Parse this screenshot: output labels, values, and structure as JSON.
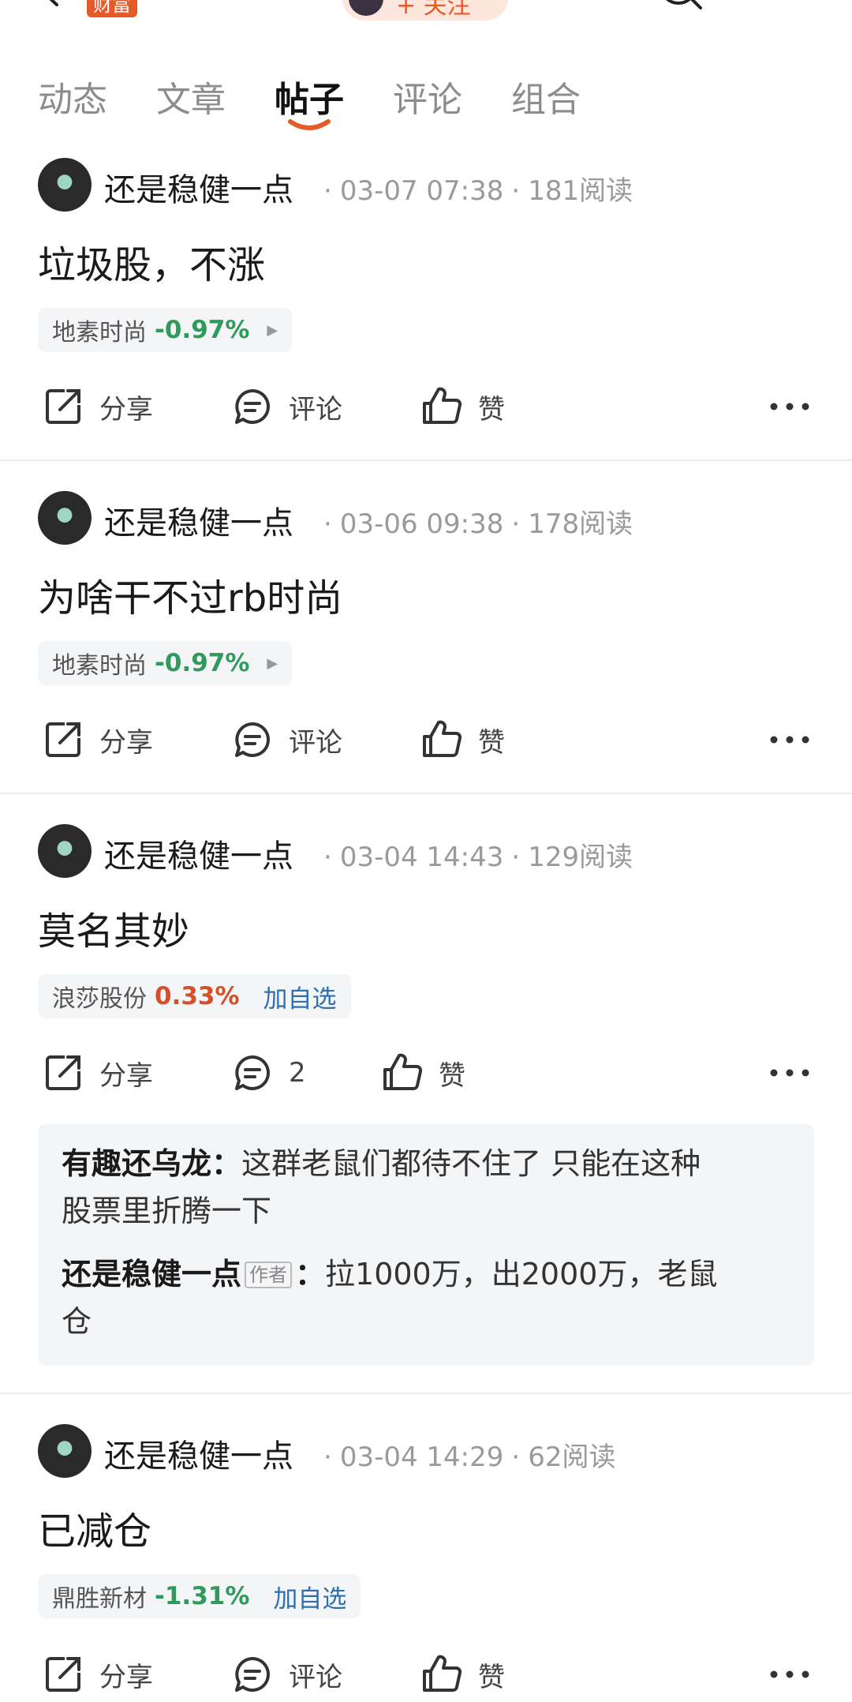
{
  "header": {
    "badge_label": "财富",
    "follow_label": "+ 关注"
  },
  "tabs": [
    {
      "label": "动态"
    },
    {
      "label": "文章"
    },
    {
      "label": "帖子"
    },
    {
      "label": "评论"
    },
    {
      "label": "组合"
    }
  ],
  "active_tab": "帖子",
  "action_labels": {
    "share": "分享",
    "comment": "评论",
    "like": "赞"
  },
  "posts": [
    {
      "author": "还是稳健一点",
      "time": "03-07 07:38",
      "reads": "181阅读",
      "content": "垃圾股，不涨",
      "stock": {
        "name": "地素时尚",
        "change": "-0.97%"
      },
      "comment_count": "评论"
    },
    {
      "author": "还是稳健一点",
      "time": "03-06 09:38",
      "reads": "178阅读",
      "content": "为啥干不过rb时尚",
      "stock": {
        "name": "地素时尚",
        "change": "-0.97%"
      },
      "comment_count": "评论"
    },
    {
      "author": "还是稳健一点",
      "time": "03-04 14:43",
      "reads": "129阅读",
      "content": "莫名其妙",
      "stock": {
        "name": "浪莎股份",
        "change": "0.33%",
        "add_watch": "加自选"
      },
      "comment_count": "2",
      "comments": [
        {
          "user": "有趣还乌龙",
          "text": "这群老鼠们都待不住了 只能在这种",
          "text2": "股票里折腾一下"
        },
        {
          "user": "还是稳健一点",
          "tag": "作者",
          "text": "拉1000万，出2000万，老鼠",
          "text2": "仓"
        }
      ]
    },
    {
      "author": "还是稳健一点",
      "time": "03-04 14:29",
      "reads": "62阅读",
      "content": "已减仓",
      "stock": {
        "name": "鼎胜新材",
        "change": "-1.31%",
        "add_watch": "加自选"
      },
      "comment_count": "评论"
    }
  ],
  "colors": {
    "accent": "#e8592a",
    "down": "#2f9a5c",
    "up": "#d4502b",
    "link": "#2f6fb0"
  }
}
